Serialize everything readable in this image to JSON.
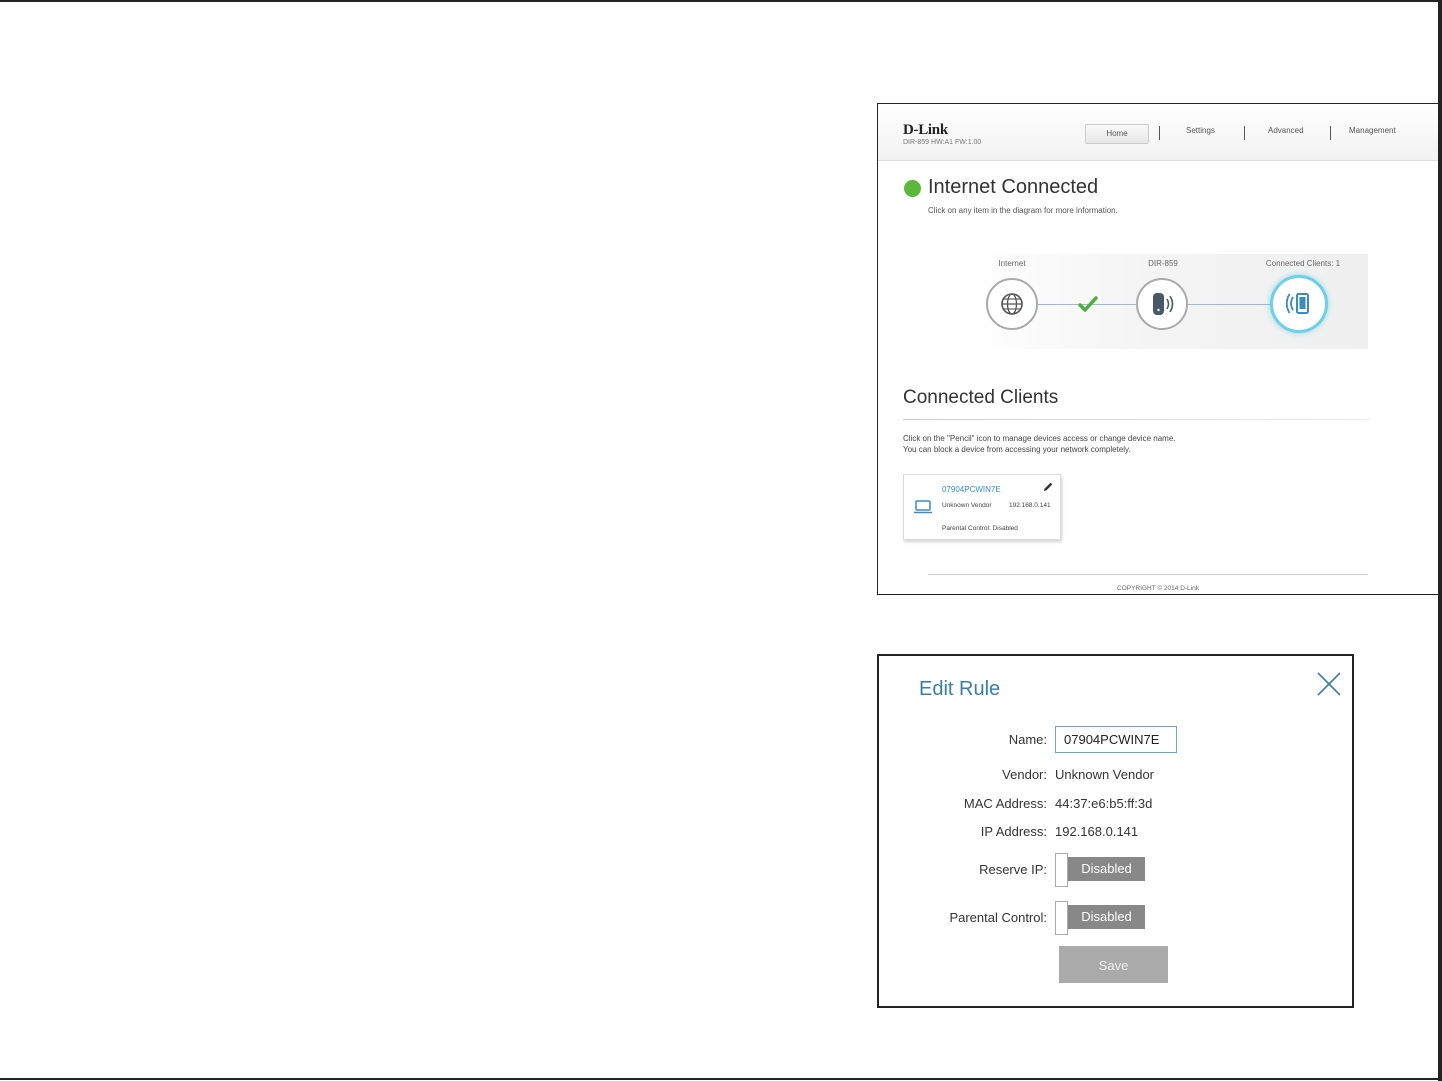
{
  "router": {
    "brand": "D-Link",
    "brand_sub": "DIR-859   HW:A1   FW:1.00",
    "nav": [
      "Home",
      "Settings",
      "Advanced",
      "Management"
    ],
    "status_title": "Internet Connected",
    "status_subtitle": "Click on any item in the diagram for more information.",
    "diagram": {
      "internet_label": "Internet",
      "router_label": "DIR-859",
      "clients_label": "Connected Clients: 1"
    },
    "clients_title": "Connected Clients",
    "clients_help_1": "Click on the \"Pencil\" icon to manage devices access or change device name.",
    "clients_help_2": "You can block a device from accessing your network completely.",
    "client": {
      "name": "07904PCWIN7E",
      "vendor": "Unknown Vendor",
      "ip": "192.168.0.141",
      "parental": "Parental Control: Disabled"
    },
    "copyright": "COPYRIGHT © 2014 D-Link",
    "colors": {
      "status_green": "#5cb83c",
      "link_blue": "#3a8dc0",
      "active_ring": "#6cd0e6"
    }
  },
  "dialog": {
    "title": "Edit Rule",
    "name_label": "Name:",
    "name_value": "07904PCWIN7E",
    "vendor_label": "Vendor:",
    "vendor_value": "Unknown Vendor",
    "mac_label": "MAC Address:",
    "mac_value": "44:37:e6:b5:ff:3d",
    "ip_label": "IP Address:",
    "ip_value": "192.168.0.141",
    "reserve_label": "Reserve IP:",
    "reserve_value": "Disabled",
    "parental_label": "Parental Control:",
    "parental_value": "Disabled",
    "save_label": "Save",
    "colors": {
      "title": "#3a7ea6",
      "toggle_track": "#888888",
      "save_button": "#aaaaaa"
    }
  }
}
